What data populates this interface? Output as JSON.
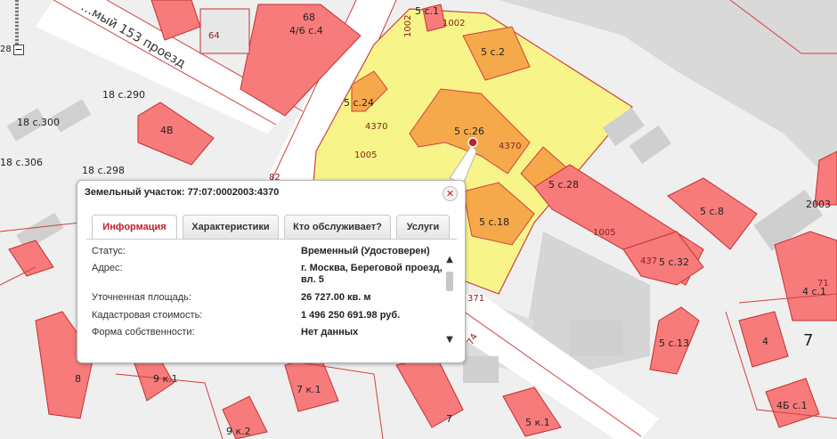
{
  "map": {
    "street_name": "…мый 153 проезд",
    "zoom_level": "28",
    "zoom_minus": "−",
    "labels": {
      "p68": "68",
      "p46c4": "4/6 с.4",
      "p64": "64",
      "p5c1": "5 с.1",
      "p1002": "1002",
      "p1002v": "1002",
      "p5c2": "5 с.2",
      "p18c290": "18 с.290",
      "p18c300": "18 с.300",
      "p4v": "4В",
      "p18c306": "18 с.306",
      "p18c298": "18 с.298",
      "p5c24": "5 с.24",
      "p4370a": "4370",
      "p5c26": "5 с.26",
      "p4370b": "4370",
      "p1005a": "1005",
      "p82": "82",
      "p5c28": "5 с.28",
      "p5c18": "5 с.18",
      "p5c8": "5 с.8",
      "p2003": "2003",
      "p1005b": "1005",
      "p437": "437",
      "p5c32": "5 с.32",
      "p71": "71",
      "p4c1": "4 с.1",
      "p371": "371",
      "p4": "4",
      "p7big": "7",
      "p5c13": "5 с.13",
      "p74": "74",
      "p8": "8",
      "p9k1": "9 к.1",
      "p7k1": "7 к.1",
      "p7": "7",
      "p5k1": "5 к.1",
      "p4bc1": "4Б с.1",
      "p9k2": "9 к.2"
    }
  },
  "popup": {
    "title": "Земельный участок: 77:07:0002003:4370",
    "tabs": [
      {
        "label": "Информация",
        "active": true
      },
      {
        "label": "Характеристики",
        "active": false
      },
      {
        "label": "Кто обслуживает?",
        "active": false
      },
      {
        "label": "Услуги",
        "active": false
      }
    ],
    "rows": [
      {
        "key": "Статус:",
        "value": "Временный (Удостоверен)"
      },
      {
        "key": "Адрес:",
        "value": "г. Москва, Береговой проезд, вл. 5"
      },
      {
        "key": "Уточненная площадь:",
        "value": "26 727.00 кв. м"
      },
      {
        "key": "Кадастровая стоимость:",
        "value": "1 496 250 691.98 руб."
      },
      {
        "key": "Форма собственности:",
        "value": "Нет данных"
      }
    ],
    "colors": {
      "accent": "#c0202a",
      "parcel_fill": "#f7f58a",
      "building_fill": "#f77b7b",
      "highlight_building": "#f5a94a"
    }
  }
}
